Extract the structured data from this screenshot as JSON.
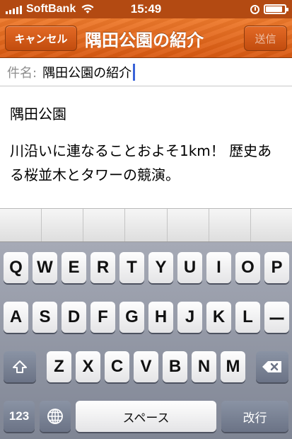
{
  "status_bar": {
    "carrier": "SoftBank",
    "time": "15:49",
    "battery_level": 0.9
  },
  "nav": {
    "cancel_label": "キャンセル",
    "title": "隅田公園の紹介",
    "send_label": "送信"
  },
  "subject": {
    "label": "件名:",
    "value": "隅田公園の紹介"
  },
  "body": {
    "paragraphs": [
      "隅田公園",
      "川沿いに連なることおよそ1km！ 歴史ある桜並木とタワーの競演。"
    ]
  },
  "keyboard": {
    "row1": [
      "Q",
      "W",
      "E",
      "R",
      "T",
      "Y",
      "U",
      "I",
      "O",
      "P"
    ],
    "row2": [
      "A",
      "S",
      "D",
      "F",
      "G",
      "H",
      "J",
      "K",
      "L",
      "ー"
    ],
    "row3": [
      "Z",
      "X",
      "C",
      "V",
      "B",
      "N",
      "M"
    ],
    "numbers_label": "123",
    "space_label": "スペース",
    "return_label": "改行",
    "icons": {
      "shift": "shift-icon",
      "delete": "delete-icon",
      "globe": "globe-icon"
    }
  },
  "colors": {
    "nav_orange": "#e2651c",
    "caret_blue": "#3a63d8"
  }
}
